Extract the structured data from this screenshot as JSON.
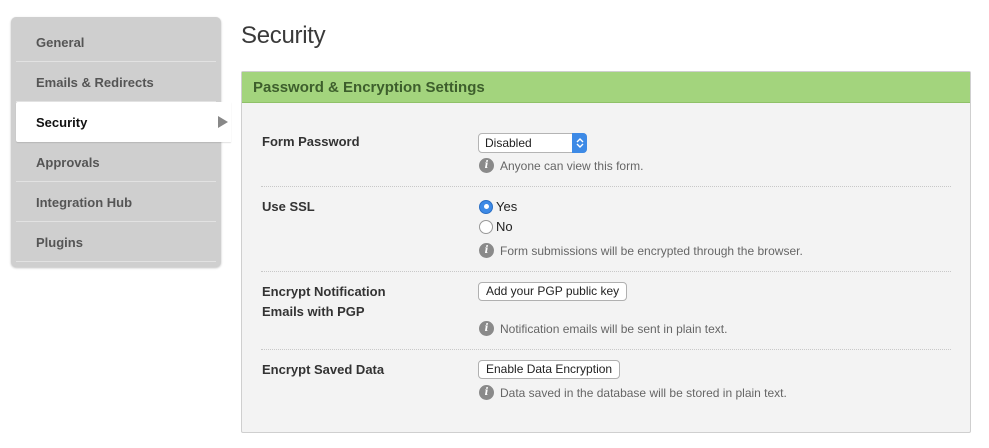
{
  "sidebar": {
    "items": [
      {
        "label": "General"
      },
      {
        "label": "Emails & Redirects"
      },
      {
        "label": "Security"
      },
      {
        "label": "Approvals"
      },
      {
        "label": "Integration Hub"
      },
      {
        "label": "Plugins"
      }
    ],
    "active": "Security"
  },
  "page": {
    "title": "Security"
  },
  "panel": {
    "header": "Password & Encryption Settings",
    "form_password": {
      "label": "Form Password",
      "selected": "Disabled",
      "help": "Anyone can view this form."
    },
    "use_ssl": {
      "label": "Use SSL",
      "options": [
        "Yes",
        "No"
      ],
      "selected": "Yes",
      "help": "Form submissions will be encrypted through the browser."
    },
    "encrypt_notification": {
      "label_line1": "Encrypt Notification",
      "label_line2": "Emails with PGP",
      "button": "Add your PGP public key",
      "help": "Notification emails will be sent in plain text."
    },
    "encrypt_saved": {
      "label": "Encrypt Saved Data",
      "button": "Enable Data Encryption",
      "help": "Data saved in the database will be stored in plain text."
    }
  },
  "colors": {
    "header_green": "#a3d47d",
    "accent_blue": "#3d8ae6"
  },
  "icons": {
    "info": "info-icon",
    "select_arrows": "chevron-up-down-icon",
    "active_arrow": "triangle-right-icon"
  }
}
